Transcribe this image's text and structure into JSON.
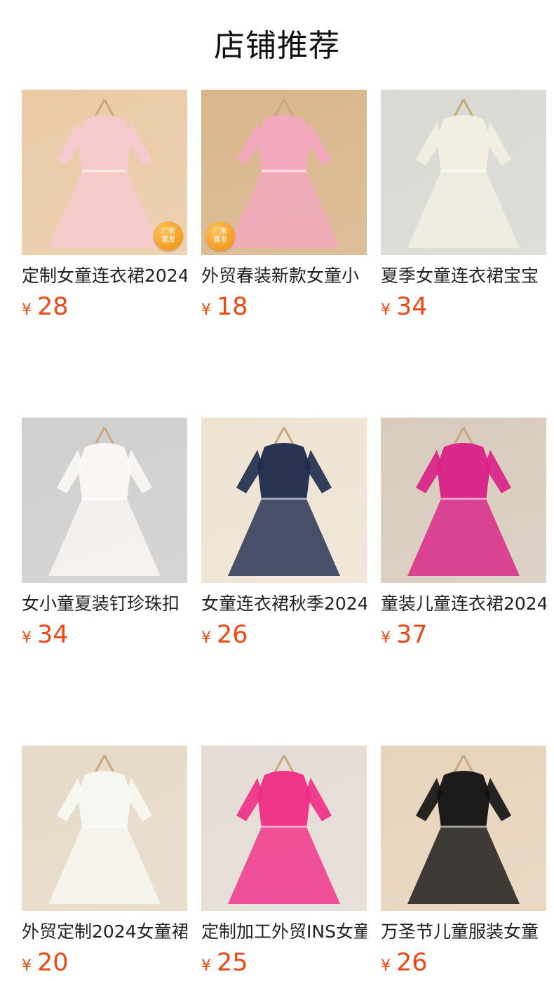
{
  "section_title": "店铺推荐",
  "currency_symbol": "¥",
  "badge_text": [
    "厂家",
    "直发"
  ],
  "products": [
    {
      "name": "定制女童连衣裙2024",
      "price": "28",
      "badge": true,
      "badge_pos": "br",
      "image": "pink-tulle-dress-image",
      "colors": [
        "#e9cba6",
        "#f7c9cf"
      ]
    },
    {
      "name": "外贸春装新款女童小",
      "price": "18",
      "badge": true,
      "badge_pos": "bl",
      "image": "pink-unicorn-dress-image",
      "colors": [
        "#d9b58a",
        "#f4a9c0"
      ]
    },
    {
      "name": "夏季女童连衣裙宝宝",
      "price": "34",
      "badge": false,
      "image": "white-lace-dress-girls-photo",
      "colors": [
        "#d9d9d4",
        "#f3efe2"
      ]
    },
    {
      "name": "女小童夏装钉珍珠扣",
      "price": "34",
      "badge": false,
      "image": "white-red-floral-dress-image",
      "colors": [
        "#cfcfcf",
        "#fbf8f5"
      ]
    },
    {
      "name": "女童连衣裙秋季2024",
      "price": "26",
      "badge": false,
      "image": "navy-rainbow-dress-image",
      "colors": [
        "#efe3d2",
        "#1d2a4c"
      ]
    },
    {
      "name": "童装儿童连衣裙2024",
      "price": "37",
      "badge": false,
      "image": "magenta-dress-girl-photo",
      "colors": [
        "#d8cbbd",
        "#d81f86"
      ]
    },
    {
      "name": "外贸定制2024女童裙",
      "price": "20",
      "badge": false,
      "image": "green-rose-dress-image",
      "colors": [
        "#e6d9c7",
        "#f7f9f4"
      ]
    },
    {
      "name": "定制加工外贸INS女童",
      "price": "25",
      "badge": false,
      "image": "good-vibes-pink-dress-image",
      "colors": [
        "#e4dcd5",
        "#ef2c85"
      ]
    },
    {
      "name": "万圣节儿童服装女童",
      "price": "26",
      "badge": false,
      "image": "halloween-boo-dress-image",
      "colors": [
        "#e6d3bb",
        "#111111"
      ]
    }
  ]
}
